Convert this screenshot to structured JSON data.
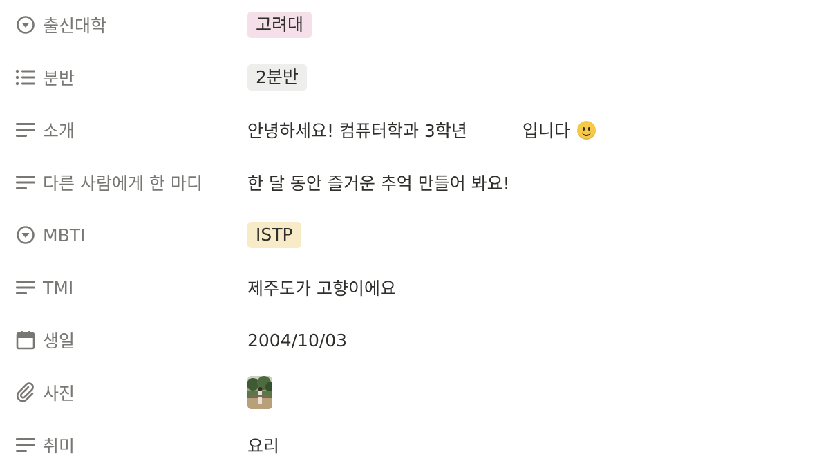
{
  "properties": [
    {
      "icon": "select-icon",
      "label": "출신대학",
      "value": "고려대"
    },
    {
      "icon": "list-icon",
      "label": "분반",
      "value": "2분반"
    },
    {
      "icon": "text-icon",
      "label": "소개",
      "value_a": "안녕하세요! 컴퓨터학과 3학년",
      "value_b": "입니다"
    },
    {
      "icon": "text-icon",
      "label": "다른 사람에게 한 마디",
      "value": "한 달 동안 즐거운 추억 만들어 봐요!"
    },
    {
      "icon": "select-icon",
      "label": "MBTI",
      "value": "ISTP"
    },
    {
      "icon": "text-icon",
      "label": "TMI",
      "value": "제주도가 고향이에요"
    },
    {
      "icon": "calendar-icon",
      "label": "생일",
      "value": "2004/10/03"
    },
    {
      "icon": "attachment-icon",
      "label": "사진"
    },
    {
      "icon": "text-icon",
      "label": "취미",
      "value": "요리"
    }
  ],
  "colors": {
    "label": "#787774",
    "value": "#2f2e2b",
    "tag_pink": "#f5e0e9",
    "tag_gray": "#eeeeed",
    "tag_yellow": "#f8ecc8"
  }
}
